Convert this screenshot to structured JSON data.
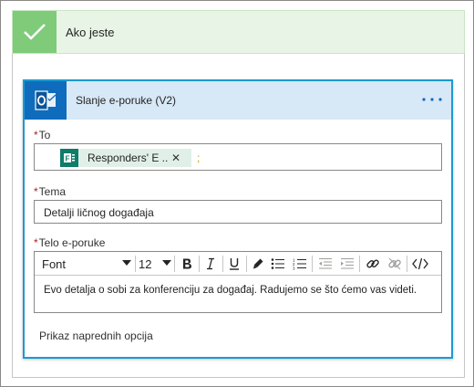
{
  "condition": {
    "title": "Ako jeste"
  },
  "action": {
    "title": "Slanje e-poruke (V2)",
    "more_glyph": "···"
  },
  "fields": {
    "to": {
      "label": "To",
      "required_mark": "*",
      "token_label": "Responders' E ...",
      "token_close": "✕",
      "separator": ";"
    },
    "subject": {
      "label": "Tema",
      "required_mark": "*",
      "value": "Detalji ličnog događaja"
    },
    "body": {
      "label": "Telo e-poruke",
      "required_mark": "*",
      "font": "Font",
      "size": "12",
      "text": "Evo detalja o sobi za konferenciju za događaj. Radujemo se što ćemo vas videti."
    }
  },
  "advanced": {
    "label": "Prikaz naprednih opcija"
  },
  "colors": {
    "success_green": "#7fcb7a",
    "accent_blue": "#1b9ad1",
    "outlook_blue": "#0f6cbd",
    "forms_green": "#107c6a",
    "required_red": "#a4262c"
  },
  "icons": {
    "condition": "checkmark-icon",
    "action": "outlook-icon",
    "token": "forms-icon",
    "toolbar": [
      "bold-icon",
      "italic-icon",
      "underline-icon",
      "color-pen-icon",
      "bullet-list-icon",
      "numbered-list-icon",
      "decrease-indent-icon",
      "increase-indent-icon",
      "link-icon",
      "unlink-icon",
      "code-view-icon"
    ]
  }
}
